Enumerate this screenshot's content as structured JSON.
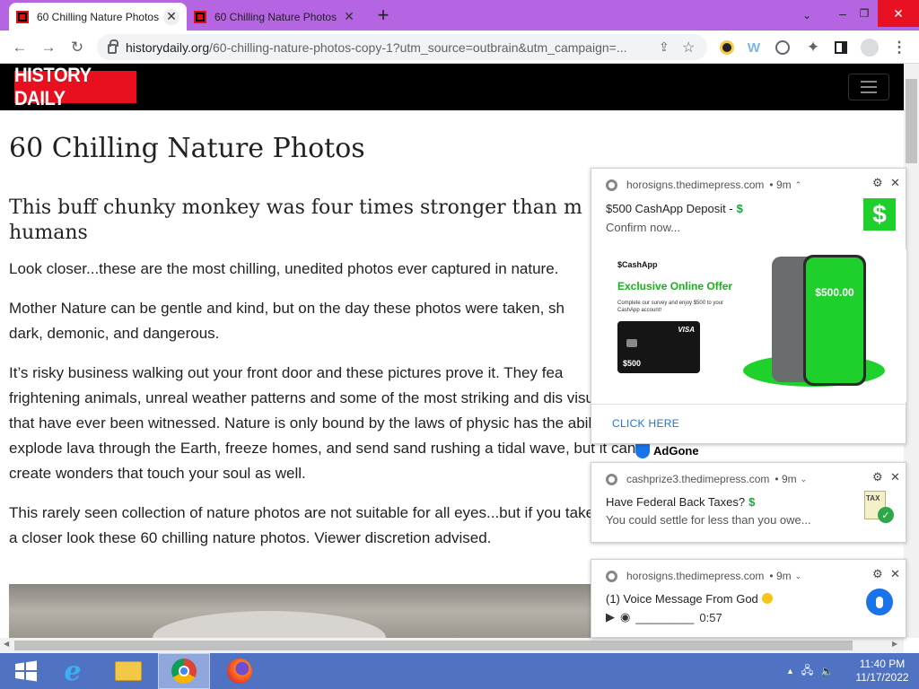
{
  "browser": {
    "tabs": [
      {
        "title": "60 Chilling Nature Photos",
        "active": true
      },
      {
        "title": "60 Chilling Nature Photos",
        "active": false
      }
    ],
    "new_tab_symbol": "+",
    "window_controls": {
      "minimize": "–",
      "restore": "❐",
      "close": "✕"
    },
    "url_domain": "historydaily.org",
    "url_path": "/60-chilling-nature-photos-copy-1?utm_source=outbrain&utm_campaign=..."
  },
  "site": {
    "logo_text": "HISTORY DAILY",
    "page_title": "60 Chilling Nature Photos",
    "subtitle": "This buff chunky monkey was four times stronger than m humans",
    "paragraphs": [
      "Look closer...these are the most chilling, unedited photos ever captured in nature.",
      "Mother Nature can be gentle and kind, but on the day these photos were taken, sh dark, demonic, and dangerous.",
      "It’s risky business walking out your front door and these pictures prove it. They fea frightening animals, unreal weather patterns and some of the most striking and dis visuals that have ever been witnessed. Nature is only bound by the laws of physic has the ability to explode lava through the Earth, freeze homes, and send sand rushing a tidal wave, but it can create wonders that touch your soul as well.",
      "This rarely seen collection of nature photos are not suitable for all eyes...but if you take a closer look these 60 chilling nature photos. Viewer discretion advised."
    ],
    "adgone_label": "AdGone"
  },
  "notifications": [
    {
      "source": "horosigns.thedimepress.com",
      "age": "• 9m",
      "title": "$500 CashApp Deposit -",
      "body": "Confirm now...",
      "ad": {
        "brand": "$CashApp",
        "headline": "Exclusive Online Offer",
        "fine_print": "Complete our survey and enjoy $500 to your CashApp account!",
        "card_brand": "VISA",
        "card_amount": "$500",
        "phone_amount": "$500.00"
      },
      "action": "CLICK HERE"
    },
    {
      "source": "cashprize3.thedimepress.com",
      "age": "• 9m",
      "title": "Have Federal Back Taxes?",
      "body": "You could settle for less than you owe...",
      "icon_label": "TAX"
    },
    {
      "source": "horosigns.thedimepress.com",
      "age": "• 9m",
      "title": "(1) Voice Message From God",
      "body_blank": "_________",
      "duration": "0:57"
    }
  ],
  "taskbar": {
    "time": "11:40 PM",
    "date": "11/17/2022"
  },
  "colors": {
    "tabstrip": "#b565e2",
    "logo_red": "#e8101f",
    "cash_green": "#1fcf2c",
    "taskbar": "#4f72c2",
    "link_blue": "#1a73e8"
  }
}
